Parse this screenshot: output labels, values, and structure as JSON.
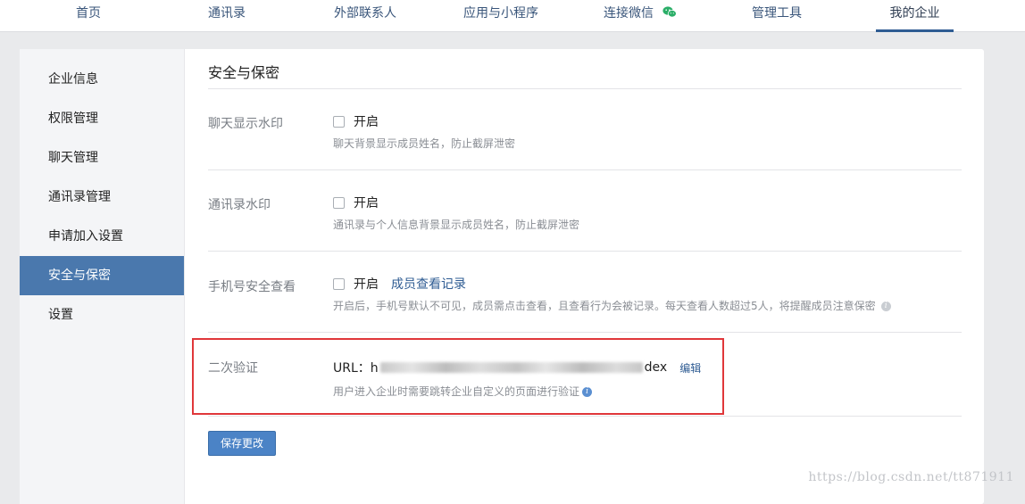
{
  "topnav": {
    "items": [
      {
        "label": "首页"
      },
      {
        "label": "通讯录"
      },
      {
        "label": "外部联系人"
      },
      {
        "label": "应用与小程序"
      },
      {
        "label": "连接微信"
      },
      {
        "label": "管理工具"
      },
      {
        "label": "我的企业"
      }
    ],
    "active": "我的企业"
  },
  "sidebar": {
    "items": [
      {
        "label": "企业信息"
      },
      {
        "label": "权限管理"
      },
      {
        "label": "聊天管理"
      },
      {
        "label": "通讯录管理"
      },
      {
        "label": "申请加入设置"
      },
      {
        "label": "安全与保密"
      },
      {
        "label": "设置"
      }
    ],
    "active": "安全与保密"
  },
  "main": {
    "title": "安全与保密",
    "rows": [
      {
        "label": "聊天显示水印",
        "checkbox_label": "开启",
        "checked": false,
        "desc": "聊天背景显示成员姓名，防止截屏泄密"
      },
      {
        "label": "通讯录水印",
        "checkbox_label": "开启",
        "checked": false,
        "desc": "通讯录与个人信息背景显示成员姓名，防止截屏泄密"
      },
      {
        "label": "手机号安全查看",
        "checkbox_label": "开启",
        "checked": false,
        "link": "成员查看记录",
        "desc": "开启后，手机号默认不可见，成员需点击查看，且查看行为会被记录。每天查看人数超过5人，将提醒成员注意保密"
      }
    ],
    "verify": {
      "label": "二次验证",
      "url_prefix": "URL：h",
      "url_suffix": "dex",
      "edit_link": "编辑",
      "desc": "用户进入企业时需要跳转企业自定义的页面进行验证"
    },
    "save_label": "保存更改"
  },
  "watermark": "https://blog.csdn.net/tt871911",
  "colors": {
    "accent": "#4a78ad",
    "button": "#4b83c6",
    "highlight_border": "#e0373a",
    "wechat_green": "#2aae67"
  }
}
